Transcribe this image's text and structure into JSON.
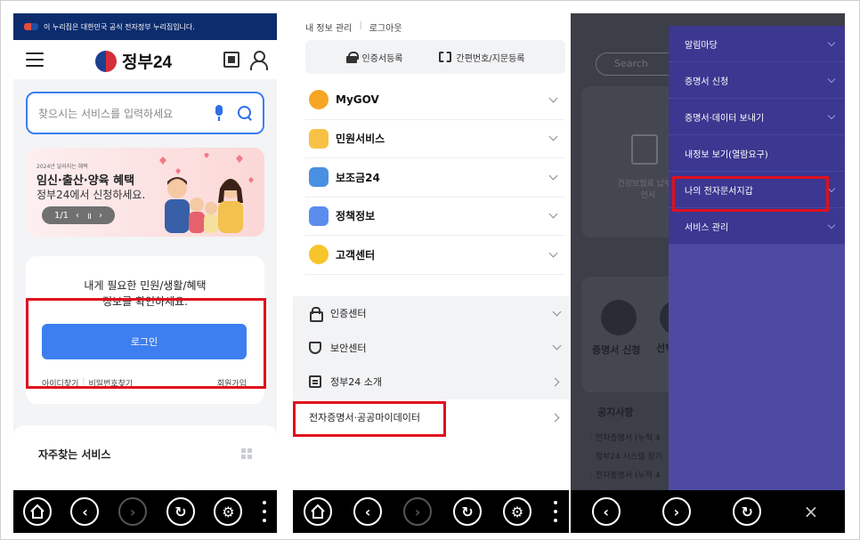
{
  "panel1": {
    "gov_banner": "이 누리집은 대한민국 공식 전자정부 누리집입니다.",
    "logo_text": "정부24",
    "search_placeholder": "찾으시는 서비스를 입력하세요",
    "promo": {
      "small": "2024년 달라지는 혜택",
      "title": "임신·출산·양육 혜택",
      "subtitle": "정부24에서 신청하세요.",
      "pager": "1/1"
    },
    "login_card": {
      "msg_line1": "내게 필요한 민원/생활/혜택",
      "msg_line2": "정보를 확인하세요.",
      "button": "로그인",
      "find_id": "아이디찾기",
      "find_pw": "비밀번호찾기",
      "join": "회원가입"
    },
    "faq_title": "자주찾는 서비스"
  },
  "panel2": {
    "top_links": [
      "내 정보 관리",
      "로그아웃"
    ],
    "cert_bar": [
      "인증서등록",
      "간편번호/지문등록"
    ],
    "menu": [
      {
        "label": "MyGOV",
        "color": "#f5a623"
      },
      {
        "label": "민원서비스",
        "color": "#f7c244"
      },
      {
        "label": "보조금24",
        "color": "#4a90e2"
      },
      {
        "label": "정책정보",
        "color": "#5b8def"
      },
      {
        "label": "고객센터",
        "color": "#f7c52b"
      }
    ],
    "sub_menu": [
      "인증센터",
      "보안센터",
      "정부24 소개"
    ],
    "highlight_item": "전자증명서·공공마이데이터"
  },
  "panel3": {
    "bg_search": "Search",
    "bg_card_text": "건강보험료 납부확인서",
    "bg_label1": "증명서 신청",
    "bg_label2": "선택",
    "bg_notice": "공지사항",
    "bg_notices": [
      "· 전자증명서 (누적 4",
      "· 정부24 시스템 정기",
      "· 전자증명서 (누적 4"
    ],
    "drawer": [
      "알림마당",
      "증명서 신청",
      "증명서·데이터 보내기",
      "내정보 보기(열람요구)",
      "나의 전자문서지갑",
      "서비스 관리"
    ],
    "highlight_index": 4
  },
  "navbar": {
    "close": "×"
  }
}
